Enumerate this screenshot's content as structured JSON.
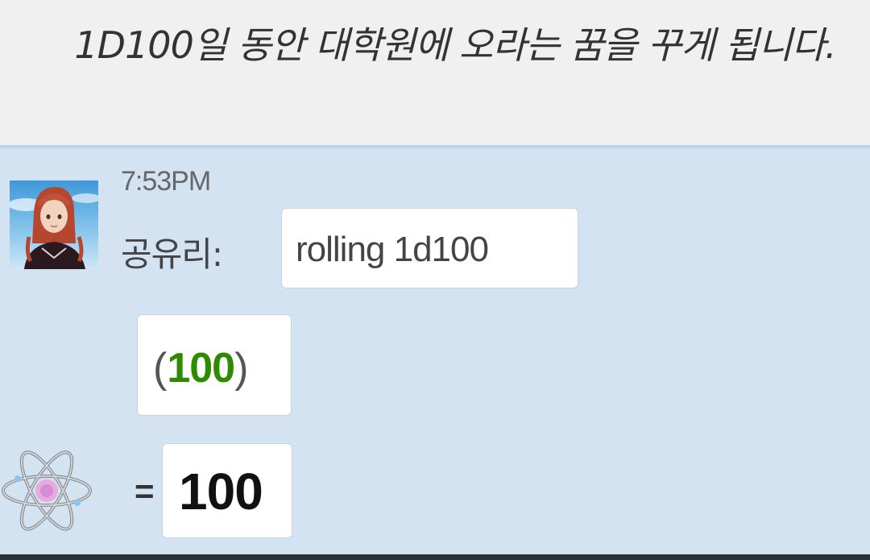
{
  "header": {
    "text": "1D100일 동안 대학원에 오라는 꿈을 꾸게 됩니다."
  },
  "message": {
    "timestamp": "7:53PM",
    "sender": "공유리:",
    "roll_text": "rolling 1d100",
    "dice_open": "(",
    "dice_value": "100",
    "dice_close": ")",
    "equals": "=",
    "total": "100"
  },
  "icons": {
    "avatar": "avatar-image",
    "bot": "atom-icon"
  },
  "colors": {
    "header_bg": "#f0f0f0",
    "chat_bg": "#d4e3f2",
    "dice_value": "#2e8b00"
  }
}
